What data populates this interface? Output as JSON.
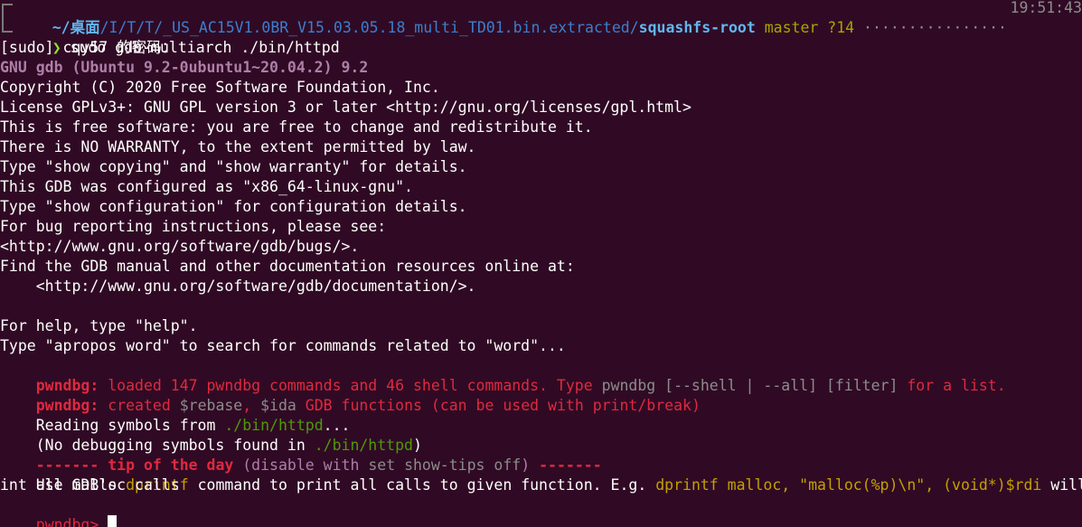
{
  "prompt": {
    "home": "~/",
    "desktop": "桌面",
    "path_mid": "/I/T/T/_US_AC15V1.0BR_V15.03.05.18_multi_TD01.bin.extracted/",
    "path_end": "squashfs-root",
    "branch": "master",
    "git_status": "?14",
    "time": "19:51:43",
    "arrow": "❯",
    "command": "sudo gdb-multiarch ./bin/httpd"
  },
  "lines": {
    "sudo": "[sudo] cqy57 的密码：",
    "gdb_version": "GNU gdb (Ubuntu 9.2-0ubuntu1~20.04.2) 9.2",
    "copyright": "Copyright (C) 2020 Free Software Foundation, Inc.",
    "license": "License GPLv3+: GNU GPL version 3 or later <http://gnu.org/licenses/gpl.html>",
    "free": "This is free software: you are free to change and redistribute it.",
    "warranty": "There is NO WARRANTY, to the extent permitted by law.",
    "show_copying": "Type \"show copying\" and \"show warranty\" for details.",
    "configured": "This GDB was configured as \"x86_64-linux-gnu\".",
    "show_config": "Type \"show configuration\" for configuration details.",
    "bug_report": "For bug reporting instructions, please see:",
    "bugs_url": "<http://www.gnu.org/software/gdb/bugs/>.",
    "find_manual": "Find the GDB manual and other documentation resources online at:",
    "doc_url": "    <http://www.gnu.org/software/gdb/documentation/>.",
    "help": "For help, type \"help\".",
    "apropos": "Type \"apropos word\" to search for commands related to \"word\"..."
  },
  "pwndbg_loaded": {
    "label": "pwndbg:",
    "text1": " loaded 147 pwndbg commands and 46 shell commands. Type ",
    "cmd": "pwndbg [--shell | --all] [filter]",
    "text2": " for a list."
  },
  "pwndbg_created": {
    "label": "pwndbg:",
    "text1": " created ",
    "rebase": "$rebase",
    "comma": ", ",
    "ida": "$ida",
    "text2": " GDB functions (can be used with print/break)"
  },
  "reading": {
    "text1": "Reading symbols from ",
    "path": "./bin/httpd",
    "text2": "..."
  },
  "nodebug": {
    "text1": "(No debugging symbols found in ",
    "path": "./bin/httpd",
    "text2": ")"
  },
  "tip": {
    "dashes1": "------- ",
    "title": "tip of the day",
    "text1": " (disable with ",
    "cmd": "set show-tips off",
    "text2": ") ",
    "dashes2": "-------"
  },
  "tip_body": {
    "text1": "Use GDB's ",
    "dprintf": "dprintf",
    "text2": " command to print all calls to given function. E.g. ",
    "example": "dprintf malloc, \"malloc(%p)\\n\", (void*)$rdi",
    "text3": " will pr",
    "wrap": "int all malloc calls"
  },
  "final_prompt": "pwndbg>"
}
